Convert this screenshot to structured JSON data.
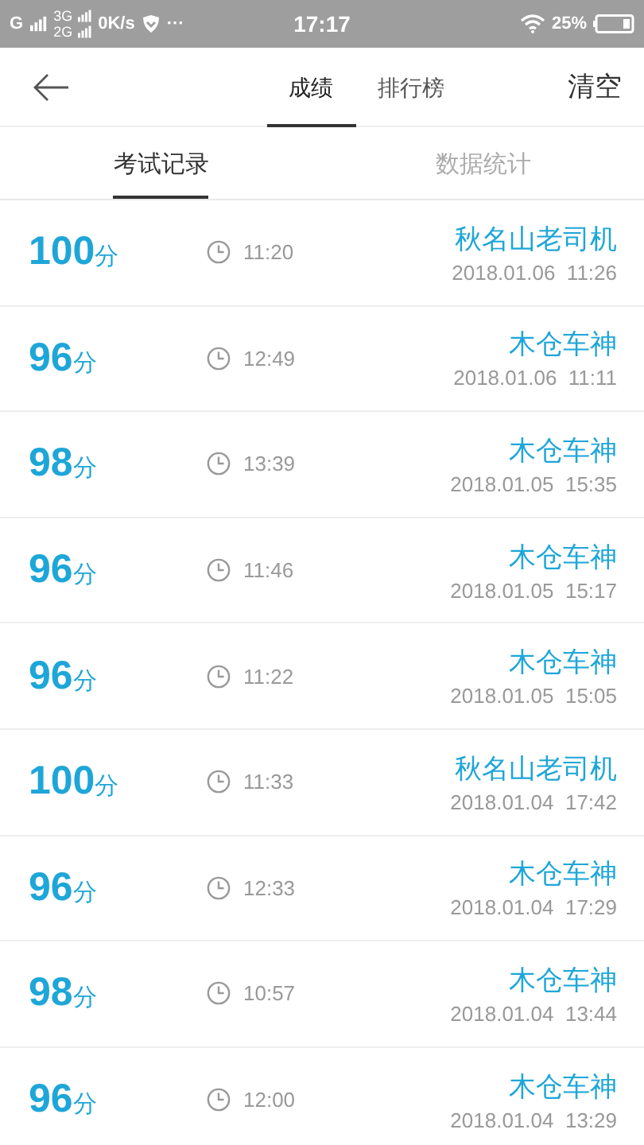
{
  "status_bar": {
    "network_1": "G",
    "network_2": "3G",
    "network_3": "2G",
    "speed": "0K/s",
    "more": "···",
    "time": "17:17",
    "battery": "25%"
  },
  "header": {
    "tabs": [
      {
        "label": "成绩",
        "selected": true
      },
      {
        "label": "排行榜",
        "selected": false
      }
    ],
    "action": "清空"
  },
  "subtabs": [
    {
      "label": "考试记录",
      "selected": true
    },
    {
      "label": "数据统计",
      "selected": false
    }
  ],
  "records": [
    {
      "score": "100",
      "unit": "分",
      "duration": "11:20",
      "name": "秋名山老司机",
      "date": "2018.01.06  11:26"
    },
    {
      "score": "96",
      "unit": "分",
      "duration": "12:49",
      "name": "木仓车神",
      "date": "2018.01.06  11:11"
    },
    {
      "score": "98",
      "unit": "分",
      "duration": "13:39",
      "name": "木仓车神",
      "date": "2018.01.05  15:35"
    },
    {
      "score": "96",
      "unit": "分",
      "duration": "11:46",
      "name": "木仓车神",
      "date": "2018.01.05  15:17"
    },
    {
      "score": "96",
      "unit": "分",
      "duration": "11:22",
      "name": "木仓车神",
      "date": "2018.01.05  15:05"
    },
    {
      "score": "100",
      "unit": "分",
      "duration": "11:33",
      "name": "秋名山老司机",
      "date": "2018.01.04  17:42"
    },
    {
      "score": "96",
      "unit": "分",
      "duration": "12:33",
      "name": "木仓车神",
      "date": "2018.01.04  17:29"
    },
    {
      "score": "98",
      "unit": "分",
      "duration": "10:57",
      "name": "木仓车神",
      "date": "2018.01.04  13:44"
    },
    {
      "score": "96",
      "unit": "分",
      "duration": "12:00",
      "name": "木仓车神",
      "date": "2018.01.04  13:29"
    }
  ]
}
